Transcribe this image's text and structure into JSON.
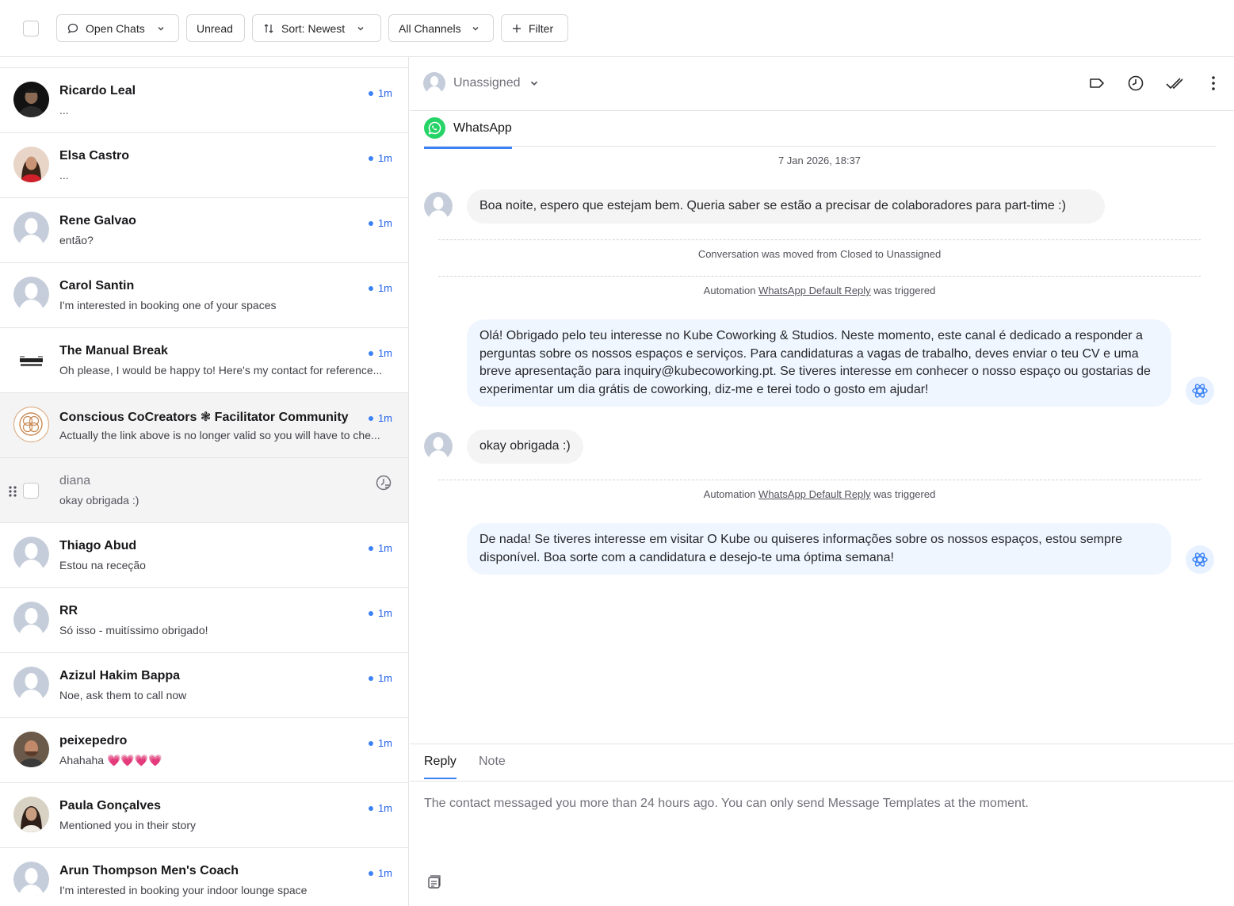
{
  "toolbar": {
    "open_chats": "Open Chats",
    "unread": "Unread",
    "sort": "Sort: Newest",
    "channels": "All Channels",
    "filter": "Filter"
  },
  "conversations": [
    {
      "name": "Ricardo Leal",
      "preview": "...",
      "time": "1m"
    },
    {
      "name": "Elsa Castro",
      "preview": "...",
      "time": "1m"
    },
    {
      "name": "Rene Galvao",
      "preview": "então?",
      "time": "1m"
    },
    {
      "name": "Carol Santin",
      "preview": "I'm interested in booking one of your spaces",
      "time": "1m"
    },
    {
      "name": "The Manual Break",
      "preview": "Oh please, I would be happy to! Here's my contact for reference...",
      "time": "1m"
    },
    {
      "name": "Conscious CoCreators ❃ Facilitator Community",
      "preview": "Actually the link above is no longer valid so you will have to che...",
      "time": "1m"
    },
    {
      "name": "diana",
      "preview": "okay obrigada :)",
      "time": ""
    },
    {
      "name": "Thiago Abud",
      "preview": "Estou na receção",
      "time": "1m"
    },
    {
      "name": "RR",
      "preview": "Só isso - muitíssimo obrigado!",
      "time": "1m"
    },
    {
      "name": "Azizul Hakim Bappa",
      "preview": "Noe, ask them to call now",
      "time": "1m"
    },
    {
      "name": "peixepedro",
      "preview": "Ahahaha 💗💗💗💗",
      "time": "1m"
    },
    {
      "name": "Paula Gonçalves",
      "preview": "Mentioned you in their story",
      "time": "1m"
    },
    {
      "name": "Arun Thompson Men's Coach",
      "preview": "I'm interested in booking your indoor lounge space",
      "time": "1m"
    }
  ],
  "logo_text": "THE MANUAL BREAK",
  "conversation": {
    "assignee": "Unassigned",
    "channel": "WhatsApp",
    "date": "7 Jan 2026, 18:37",
    "msg1": "Boa noite, espero que estejam bem. Queria saber se estão a precisar de colaboradores para part-time :)",
    "sys1": "Conversation was moved from Closed to Unassigned",
    "sys2_prefix": "Automation ",
    "sys2_link": "WhatsApp Default Reply",
    "sys2_suffix": " was triggered",
    "msg2": "Olá! Obrigado pelo teu interesse no Kube Coworking & Studios. Neste momento, este canal é dedicado a responder a perguntas sobre os nossos espaços e serviços. Para candidaturas a vagas de trabalho, deves enviar o teu CV e uma breve apresentação para inquiry@kubecoworking.pt. Se tiveres interesse em conhecer o nosso espaço ou gostarias de experimentar um dia grátis de coworking, diz-me e terei todo o gosto em ajudar!",
    "msg3": "okay obrigada :)",
    "sys3_prefix": "Automation ",
    "sys3_link": "WhatsApp Default Reply",
    "sys3_suffix": " was triggered",
    "msg4": "De nada! Se tiveres interesse em visitar O Kube ou quiseres informações sobre os nossos espaços, estou sempre disponível. Boa sorte com a candidatura e desejo-te uma óptima semana!"
  },
  "reply": {
    "tab_reply": "Reply",
    "tab_note": "Note",
    "notice": "The contact messaged you more than 24 hours ago. You can only send Message Templates at the moment."
  },
  "colors": {
    "accent": "#3b82f6",
    "whatsapp": "#25d366",
    "inbound_bubble": "#f4f4f5",
    "outbound_bubble": "#eff6ff"
  }
}
